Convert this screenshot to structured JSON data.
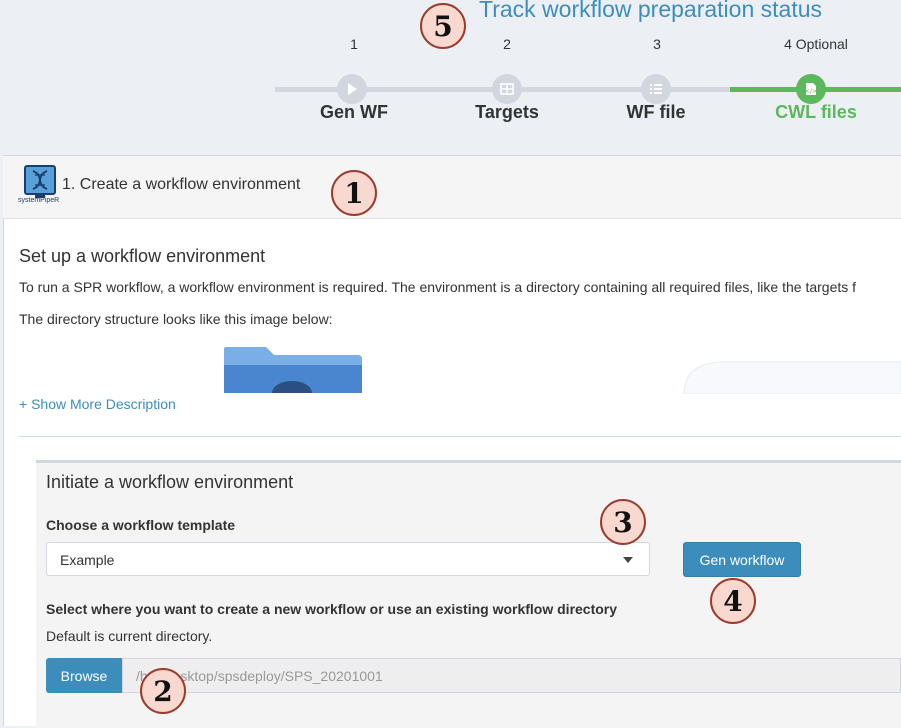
{
  "tracker": {
    "title": "Track workflow preparation status",
    "steps": [
      {
        "num": "1",
        "label": "Gen WF",
        "icon": "play-icon"
      },
      {
        "num": "2",
        "label": "Targets",
        "icon": "table-icon"
      },
      {
        "num": "3",
        "label": "WF file",
        "icon": "list-icon"
      },
      {
        "num": "4 Optional",
        "label": "CWL files",
        "icon": "file-code-icon",
        "active": true
      }
    ],
    "colors": {
      "active": "#5cb85c",
      "inactive": "#d2d6de",
      "title": "#3c8dbc"
    }
  },
  "callouts": [
    "1",
    "2",
    "3",
    "4",
    "5"
  ],
  "box": {
    "logo_text": "systemPipeR",
    "title": "1. Create a workflow environment"
  },
  "intro": {
    "heading": "Set up a workflow environment",
    "p1": "To run a SPR workflow, a workflow environment is required. The environment is a directory containing all required files, like the targets f",
    "p2": "The directory structure looks like this image below:",
    "show_more": "+ Show More Description"
  },
  "panel": {
    "title": "Initiate a workflow environment",
    "template_label": "Choose a workflow template",
    "template_value": "Example",
    "gen_button": "Gen workflow",
    "dir_label": "Select where you want to create a new workflow or use an existing workflow directory",
    "dir_hint": "Default is current directory.",
    "browse_button": "Browse",
    "dir_path": "/h        z/Desktop/spsdeploy/SPS_20201001"
  },
  "accent": "#3c8dbc"
}
